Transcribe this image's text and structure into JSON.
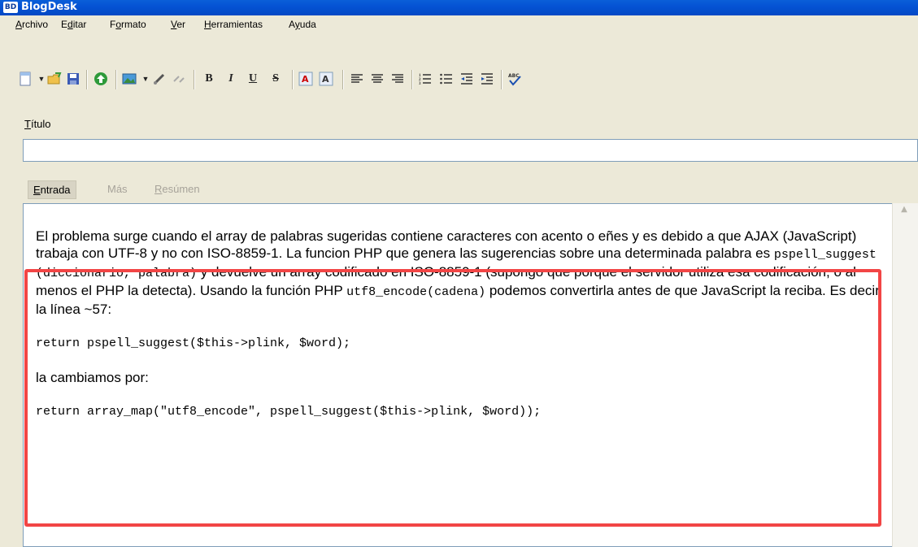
{
  "window": {
    "app_icon": "BD",
    "title": "BlogDesk"
  },
  "menu": [
    {
      "pre": "",
      "u": "A",
      "post": "rchivo"
    },
    {
      "pre": "E",
      "u": "d",
      "post": "itar"
    },
    {
      "pre": "F",
      "u": "o",
      "post": "rmato"
    },
    {
      "pre": "",
      "u": "V",
      "post": "er"
    },
    {
      "pre": "",
      "u": "H",
      "post": "erramientas"
    },
    {
      "pre": "A",
      "u": "y",
      "post": "uda"
    }
  ],
  "toolbar": {
    "bold": "B",
    "italic": "I",
    "underline": "U",
    "strike": "S",
    "spell_label": "ABC"
  },
  "title_label": {
    "u": "T",
    "rest": "ítulo"
  },
  "title_value": "",
  "tabs": [
    {
      "u": "E",
      "rest": "ntrada",
      "state": "active"
    },
    {
      "u": "",
      "rest": "Más",
      "state": "disabled"
    },
    {
      "u": "R",
      "rest": "esúmen",
      "state": "disabled"
    }
  ],
  "body": {
    "p1": "El problema surge cuando el array de palabras sugeridas contiene caracteres con acento o eñes y es debido a que AJAX (JavaScript) trabaja con UTF-8 y no con ISO-8859-1. La funcion PHP que genera las sugerencias sobre una determinada palabra es ",
    "p1_code": "pspell_suggest (diccionario, palabra)",
    "p1b": " y devuelve un array codificado en ISO-8859-1 (supongo que porque el servidor utiliza esa codificación, o al menos el PHP la detecta). Usando la función PHP ",
    "p1_code2": "utf8_encode(cadena)",
    "p1c": " podemos convertirla antes de que JavaScript la reciba. Es decir la línea ~57:",
    "code1": "return pspell_suggest($this->plink, $word);",
    "p2": "la cambiamos por:",
    "code2": "return array_map(\"utf8_encode\", pspell_suggest($this->plink, $word));"
  },
  "colors": {
    "titlebar": "#0553d4",
    "highlight": "#f24545"
  }
}
